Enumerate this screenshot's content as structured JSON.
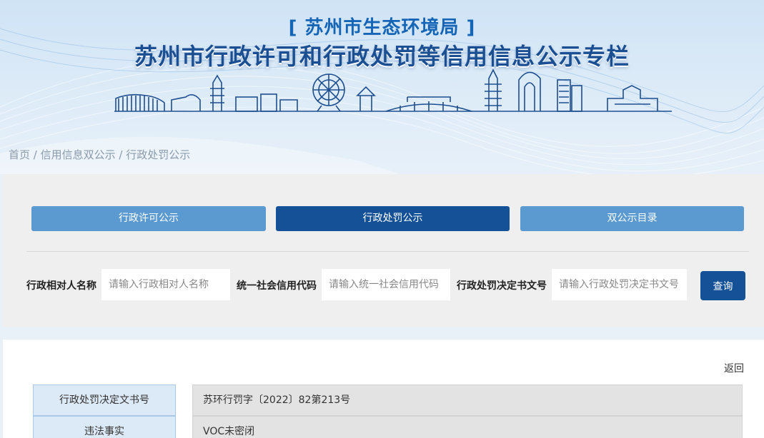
{
  "header": {
    "agency": "[ 苏州市生态环境局 ]",
    "title": "苏州市行政许可和行政处罚等信用信息公示专栏"
  },
  "breadcrumb": {
    "home": "首页",
    "sep1": " / ",
    "level1": "信用信息双公示",
    "sep2": " / ",
    "level2": "行政处罚公示"
  },
  "tabs": [
    {
      "label": "行政许可公示",
      "active": false
    },
    {
      "label": "行政处罚公示",
      "active": true
    },
    {
      "label": "双公示目录",
      "active": false
    }
  ],
  "search": {
    "name_label": "行政相对人名称",
    "name_placeholder": "请输入行政相对人名称",
    "code_label": "统一社会信用代码",
    "code_placeholder": "请输入统一社会信用代码",
    "doc_label": "行政处罚决定书文号",
    "doc_placeholder": "请输入行政处罚决定书文号",
    "button": "查询"
  },
  "detail": {
    "back": "返回",
    "rows": [
      {
        "key": "行政处罚决定文书号",
        "value": "苏环行罚字〔2022〕82第213号"
      },
      {
        "key": "违法事实",
        "value": "VOC未密闭"
      }
    ]
  },
  "colors": {
    "primary_dark": "#145196",
    "primary_light": "#5a9ad0",
    "title_blue": "#1b4f93",
    "agency_blue": "#1565b7"
  }
}
